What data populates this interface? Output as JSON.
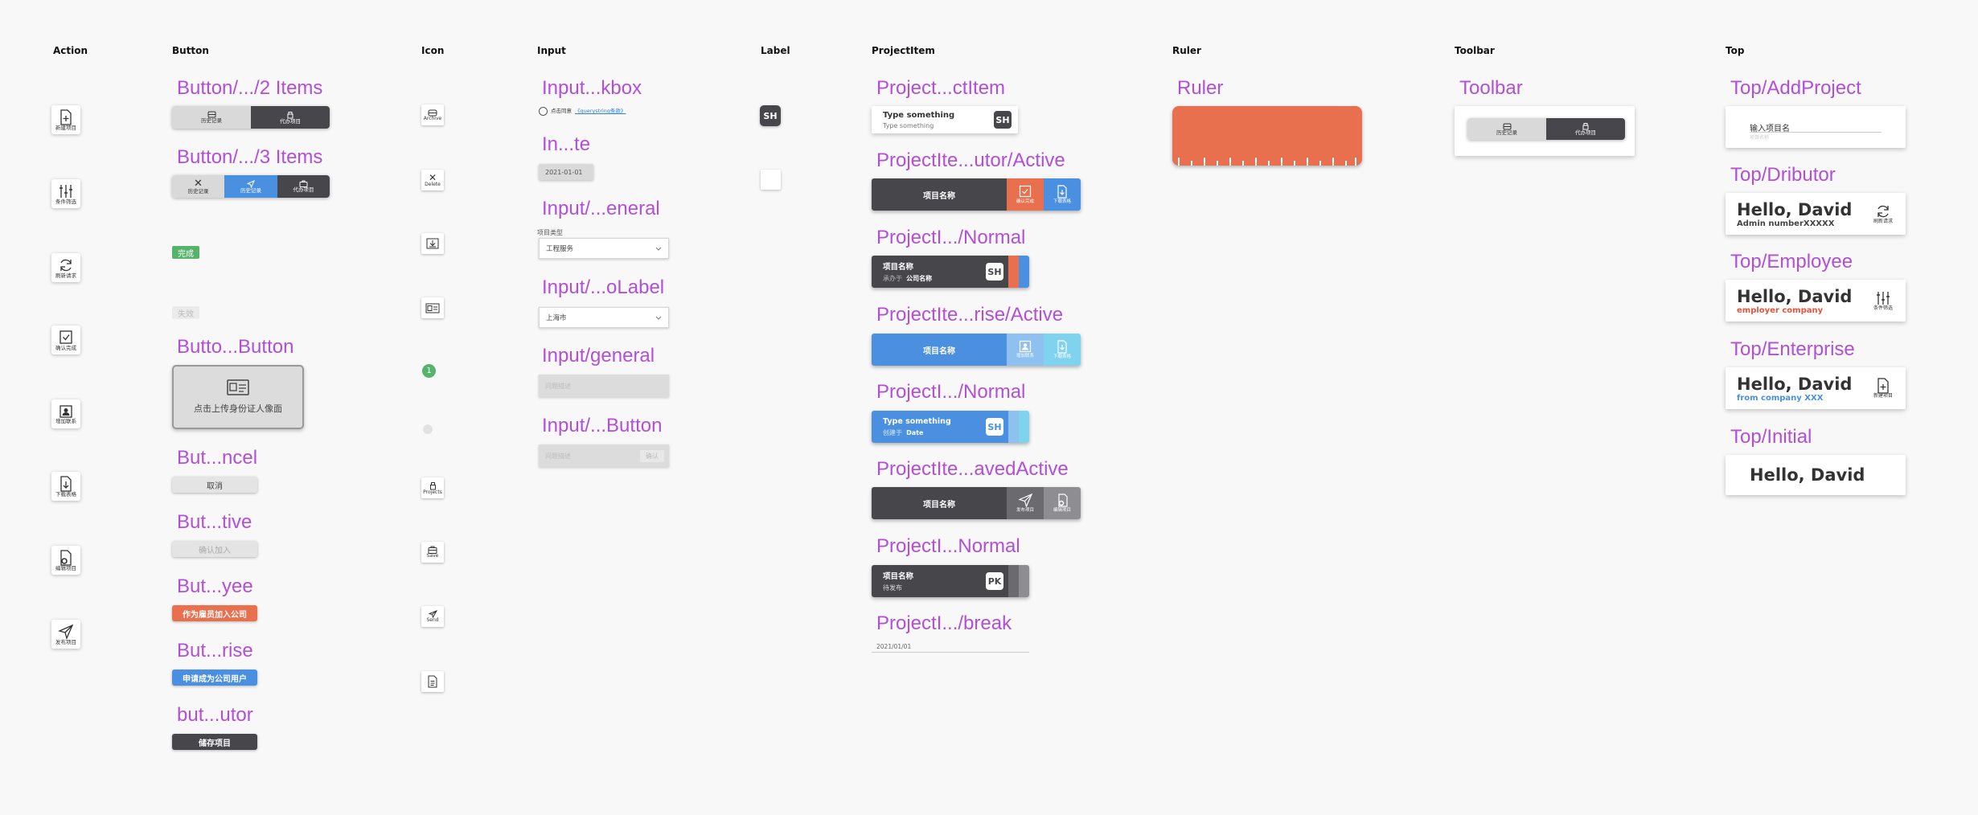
{
  "sections": {
    "action": "Action",
    "button": "Button",
    "icon": "Icon",
    "input": "Input",
    "label": "Label",
    "project_item": "ProjectItem",
    "ruler": "Ruler",
    "toolbar": "Toolbar",
    "top": "Top"
  },
  "action_icons": [
    "新建项目",
    "条件筛选",
    "刷新请求",
    "确认完成",
    "增加联系",
    "下载表格",
    "编辑项目",
    "发布项目"
  ],
  "buttons": {
    "two_items_title": "Button/.../2 Items",
    "two_items": [
      "历史记录",
      "代办项目"
    ],
    "three_items_title": "Button/.../3 Items",
    "three_items": [
      "历史记录",
      "历史记录",
      "代办项目"
    ],
    "done_badge": "完成",
    "disabled_badge": "失效",
    "upload_title": "Butto...Button",
    "upload_label": "点击上传身份证人像面",
    "cancel_title": "But...ncel",
    "cancel_label": "取消",
    "inactive_title": "But...tive",
    "inactive_label": "确认加入",
    "employee_title": "But...yee",
    "employee_label": "作为雇员加入公司",
    "enterprise_title": "But...rise",
    "enterprise_label": "申请成为公司用户",
    "distributor_title": "but...utor",
    "distributor_label": "储存项目"
  },
  "icons": {
    "archive": "Archive",
    "delete": "Delete",
    "badge_count": "1",
    "projects": "Projects",
    "save": "Save",
    "send": "Send"
  },
  "inputs": {
    "checkbox_title": "Input...kbox",
    "checkbox_text": "点击同意",
    "checkbox_link": "《querystring条款》",
    "date_title": "In...te",
    "date_value": "2021-01-01",
    "general_label_title": "Input/...eneral",
    "general_label": "项目类型",
    "general_value": "工程服务",
    "nolabel_title": "Input/...oLabel",
    "nolabel_value": "上海市",
    "general_title": "Input/general",
    "general_placeholder": "问题描述",
    "button_title": "Input/...Button",
    "button_placeholder": "问题描述",
    "button_label": "确认"
  },
  "labels": {
    "avatar": "SH"
  },
  "project_items": {
    "item_title": "Project...ctItem",
    "item_name": "Type something",
    "item_sub": "Type something",
    "item_badge": "SH",
    "distributor_active_title": "ProjectIte...utor/Active",
    "distributor_active_name": "项目名称",
    "distributor_active_actions": [
      "确认完成",
      "下载表格"
    ],
    "normal1_title": "ProjectI.../Normal",
    "normal1_name": "项目名称",
    "normal1_prefix": "承办于",
    "normal1_company": "公司名称",
    "normal1_badge": "SH",
    "enterprise_active_title": "ProjectIte...rise/Active",
    "enterprise_active_name": "项目名称",
    "enterprise_active_actions": [
      "增加联系",
      "下载表格"
    ],
    "normal2_title": "ProjectI.../Normal",
    "normal2_name": "Type something",
    "normal2_prefix": "创建于",
    "normal2_date": "Date",
    "normal2_badge": "SH",
    "saved_active_title": "ProjectIte...avedActive",
    "saved_active_name": "项目名称",
    "saved_active_actions": [
      "发布项目",
      "编辑项目"
    ],
    "normal3_title": "ProjectI...Normal",
    "normal3_name": "项目名称",
    "normal3_status": "待发布",
    "normal3_badge": "PK",
    "break_title": "ProjectI.../break",
    "break_date": "2021/01/01"
  },
  "ruler": {
    "title": "Ruler"
  },
  "toolbar": {
    "title": "Toolbar",
    "items": [
      "历史记录",
      "代办项目"
    ]
  },
  "top": {
    "add_title": "Top/AddProject",
    "add_label": "输入项目名",
    "add_placeholder": "项目名称",
    "distributor_title": "Top/Dributor",
    "distributor_hello": "Hello, David",
    "distributor_sub": "Admin numberXXXXX",
    "distributor_action": "刷新请求",
    "employee_title": "Top/Employee",
    "employee_hello": "Hello, David",
    "employee_sub": "employer company",
    "employee_action": "条件筛选",
    "enterprise_title": "Top/Enterprise",
    "enterprise_hello": "Hello, David",
    "enterprise_sub": "from company XXX",
    "enterprise_action": "新建项目",
    "initial_title": "Top/Initial",
    "initial_hello": "Hello, David"
  },
  "colors": {
    "accent_purple": "#b24fd6",
    "dark": "#47474b",
    "blue": "#4a8fe0",
    "orange": "#e8704f",
    "green": "#55b46a",
    "light_blue": "#7fd3ee",
    "grey": "#d9d9d9",
    "red_text": "#e8533a"
  }
}
